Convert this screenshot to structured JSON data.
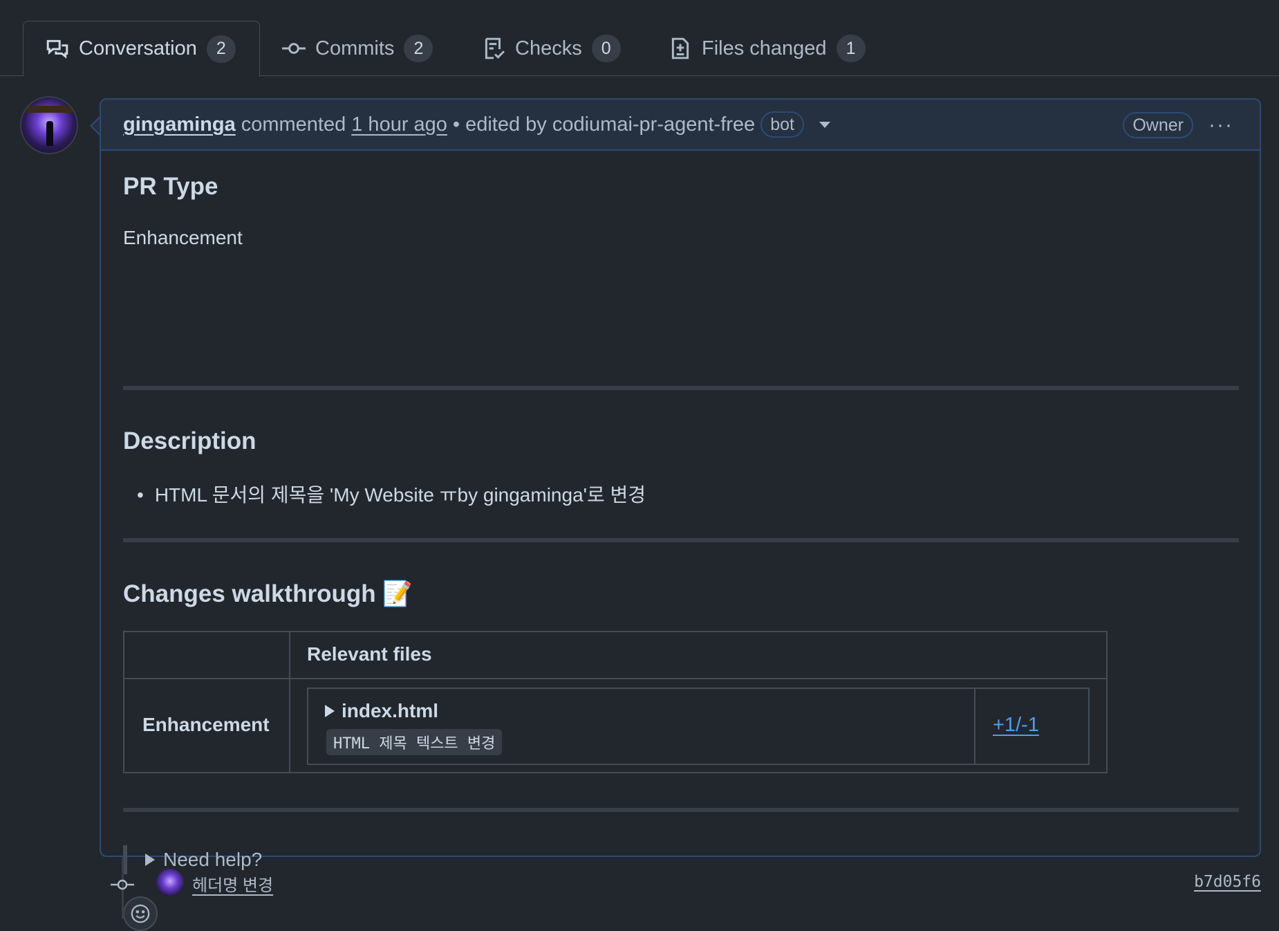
{
  "tabs": [
    {
      "label": "Conversation",
      "count": "2",
      "icon": "comment-discussion-icon",
      "active": true
    },
    {
      "label": "Commits",
      "count": "2",
      "icon": "git-commit-icon"
    },
    {
      "label": "Checks",
      "count": "0",
      "icon": "checklist-icon"
    },
    {
      "label": "Files changed",
      "count": "1",
      "icon": "file-diff-icon"
    }
  ],
  "comment": {
    "author": "gingaminga",
    "action": "commented",
    "time": "1 hour ago",
    "separator": "•",
    "edited_by": "edited by codiumai-pr-agent-free",
    "bot_label": "bot",
    "role": "Owner",
    "more": "···"
  },
  "body": {
    "pr_type_heading": "PR Type",
    "pr_type_value": "Enhancement",
    "description_heading": "Description",
    "description_items": [
      "HTML 문서의 제목을 'My Website ㅠby gingaminga'로 변경"
    ],
    "walkthrough_heading": "Changes walkthrough 📝",
    "table": {
      "header": "Relevant files",
      "category": "Enhancement",
      "file_name": "index.html",
      "file_summary": "HTML 제목 텍스트 변경",
      "diff": "+1/-1"
    },
    "help": "Need help?"
  },
  "timeline": {
    "commit_message": "헤더명 변경",
    "commit_sha": "b7d05f6"
  },
  "colors": {
    "background": "#22272e",
    "header_bg": "#253041",
    "border_accent": "#2d4b74",
    "link": "#539bf5"
  }
}
